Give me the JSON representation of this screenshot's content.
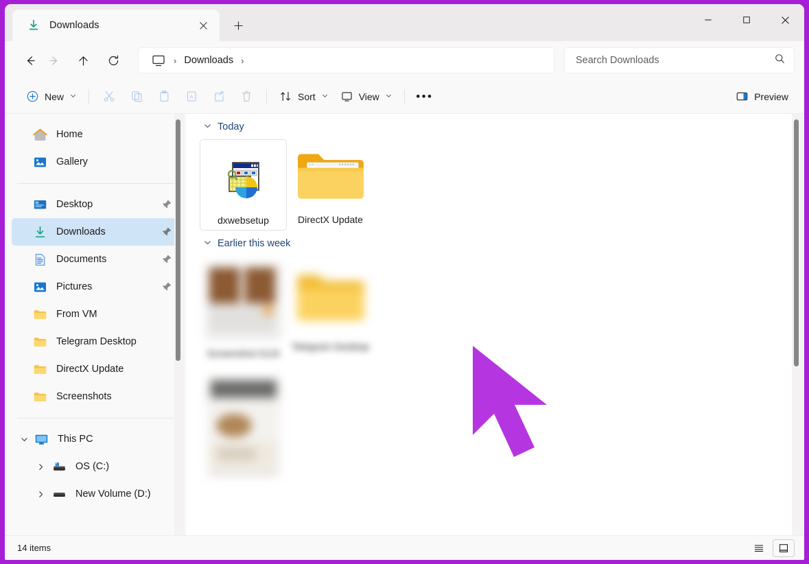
{
  "window": {
    "border_color": "#a61fd6",
    "controls": {
      "minimize": "minimize-button",
      "maximize": "maximize-button",
      "close": "close-button"
    }
  },
  "tab": {
    "title": "Downloads",
    "icon": "download-icon",
    "close_label": "✕",
    "newtab_label": "+"
  },
  "address": {
    "back": "back-arrow",
    "forward": "forward-arrow",
    "up": "up-arrow",
    "refresh": "refresh-icon",
    "breadcrumb": {
      "root_icon": "this-pc-icon",
      "current": "Downloads",
      "sep": "›"
    }
  },
  "search": {
    "placeholder": "Search Downloads",
    "value": "",
    "icon": "search-icon"
  },
  "toolbar": {
    "new_label": "New",
    "cut_label": "Cut",
    "copy_label": "Copy",
    "paste_label": "Paste",
    "rename_label": "Rename",
    "share_label": "Share",
    "delete_label": "Delete",
    "sort_label": "Sort",
    "view_label": "View",
    "more_label": "•••",
    "preview_label": "Preview",
    "chevron": "⌄"
  },
  "sidebar": {
    "groups": [
      {
        "items": [
          {
            "label": "Home",
            "icon": "home-icon",
            "pinned": false,
            "selected": false
          },
          {
            "label": "Gallery",
            "icon": "gallery-icon",
            "pinned": false,
            "selected": false
          }
        ]
      },
      {
        "items": [
          {
            "label": "Desktop",
            "icon": "desktop-icon",
            "pinned": true,
            "selected": false
          },
          {
            "label": "Downloads",
            "icon": "downloads-icon",
            "pinned": true,
            "selected": true
          },
          {
            "label": "Documents",
            "icon": "documents-icon",
            "pinned": true,
            "selected": false
          },
          {
            "label": "Pictures",
            "icon": "pictures-icon",
            "pinned": true,
            "selected": false
          },
          {
            "label": "From VM",
            "icon": "folder-icon",
            "pinned": false,
            "selected": false
          },
          {
            "label": "Telegram Desktop",
            "icon": "folder-icon",
            "pinned": false,
            "selected": false
          },
          {
            "label": "DirectX Update",
            "icon": "folder-icon",
            "pinned": false,
            "selected": false
          },
          {
            "label": "Screenshots",
            "icon": "folder-icon",
            "pinned": false,
            "selected": false
          }
        ]
      },
      {
        "items": [
          {
            "label": "This PC",
            "icon": "this-pc-icon",
            "expanded": true,
            "level": 1
          },
          {
            "label": "OS (C:)",
            "icon": "hard-drive-icon",
            "expanded": false,
            "level": 2
          },
          {
            "label": "New Volume (D:)",
            "icon": "drive-icon",
            "expanded": false,
            "level": 2
          }
        ]
      }
    ]
  },
  "content": {
    "groups": [
      {
        "header": "Today",
        "items": [
          {
            "label": "dxwebsetup",
            "icon": "installer-icon",
            "selected": true,
            "blurred": false
          },
          {
            "label": "DirectX Update",
            "icon": "folder-with-document-icon",
            "selected": false,
            "blurred": false
          }
        ]
      },
      {
        "header": "Earlier this week",
        "items": [
          {
            "label": "",
            "icon": "image-thumbnail",
            "selected": false,
            "blurred": true
          },
          {
            "label": "",
            "icon": "folder-icon",
            "selected": false,
            "blurred": true
          },
          {
            "label": "",
            "icon": "image-thumbnail",
            "selected": false,
            "blurred": true
          }
        ]
      }
    ]
  },
  "status": {
    "item_count": "14 items",
    "view_list": "list-view-toggle",
    "view_details": "details-view-toggle"
  },
  "colors": {
    "accent": "#0f6cbd",
    "selection": "#cfe4f7",
    "folder": "#f7c244",
    "cursor": "#b536e0",
    "group_header": "#1f4478"
  }
}
